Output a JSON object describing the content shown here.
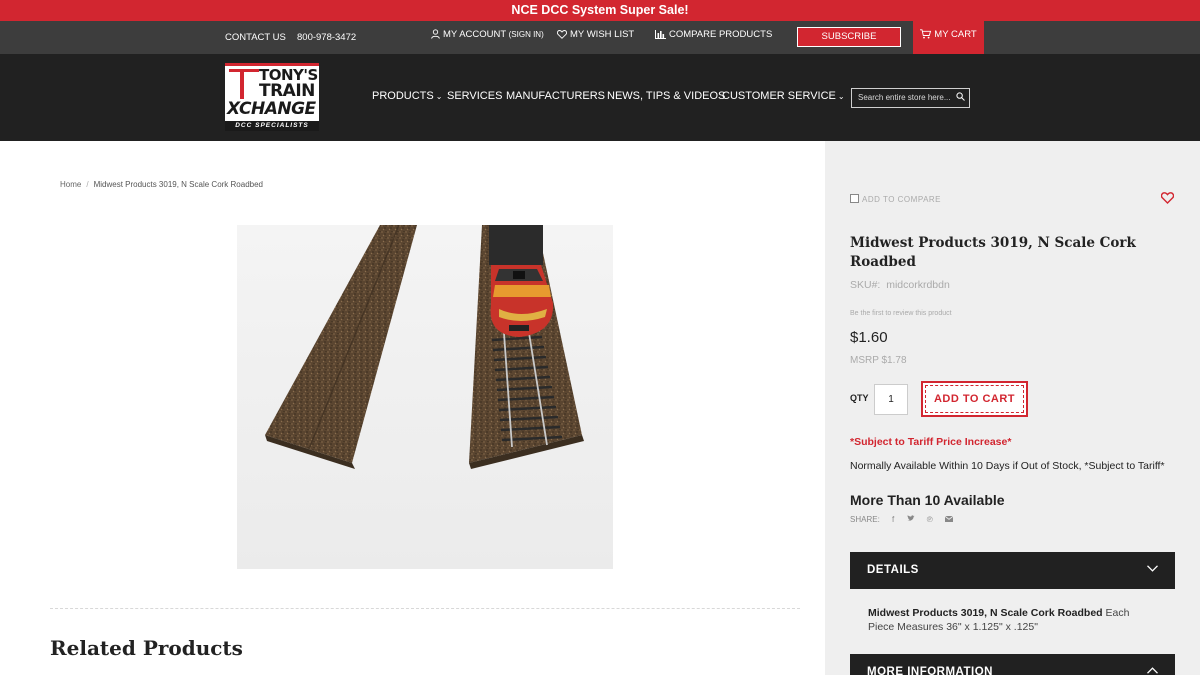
{
  "promo": {
    "text": "NCE DCC System Super Sale!"
  },
  "utility": {
    "contact": "CONTACT US",
    "phone": "800-978-3472",
    "account": "MY ACCOUNT",
    "account_sub": "(SIGN IN)",
    "wishlist": "MY WISH LIST",
    "compare": "COMPARE PRODUCTS",
    "subscribe": "SUBSCRIBE",
    "cart": "MY CART"
  },
  "logo": {
    "line1": "TONY'S",
    "line2": "TRAIN",
    "line3": "XCHANGE",
    "tagline": "DCC SPECIALISTS"
  },
  "nav": {
    "products": "PRODUCTS",
    "services": "SERVICES",
    "manufacturers": "MANUFACTURERS",
    "news": "NEWS, TIPS & VIDEOS",
    "customer_service": "CUSTOMER SERVICE"
  },
  "search": {
    "placeholder": "Search entire store here..."
  },
  "breadcrumb": {
    "home": "Home",
    "separator": "/",
    "current": "Midwest Products 3019, N Scale Cork Roadbed"
  },
  "product": {
    "add_to_compare": "ADD TO COMPARE",
    "title": "Midwest Products 3019, N Scale Cork Roadbed",
    "sku_label": "SKU#:",
    "sku": "midcorkrdbdn",
    "review_prompt": "Be the first to review this product",
    "price": "$1.60",
    "msrp": "MSRP $1.78",
    "qty_label": "QTY",
    "qty_value": "1",
    "add_to_cart": "ADD TO CART",
    "tariff_note": "*Subject to Tariff Price Increase*",
    "availability_note": "Normally Available Within 10 Days if Out of Stock, *Subject to Tariff*",
    "stock": "More Than 10 Available",
    "share_label": "SHARE:"
  },
  "details": {
    "header": "DETAILS",
    "desc_bold": "Midwest Products 3019, N Scale Cork Roadbed",
    "desc_rest": " Each Piece Measures 36\" x 1.125\" x .125\"",
    "more_info_header": "MORE INFORMATION"
  },
  "related": {
    "title": "Related Products"
  },
  "colors": {
    "brand_red": "#d22630",
    "dark": "#212121",
    "utility": "#3d3d3d",
    "panel": "#efefef"
  },
  "icons": [
    "user-icon",
    "heart-icon",
    "bar-chart-icon",
    "cart-icon",
    "search-icon",
    "chevron-down-icon",
    "facebook-icon",
    "twitter-icon",
    "pinterest-icon",
    "email-icon"
  ]
}
